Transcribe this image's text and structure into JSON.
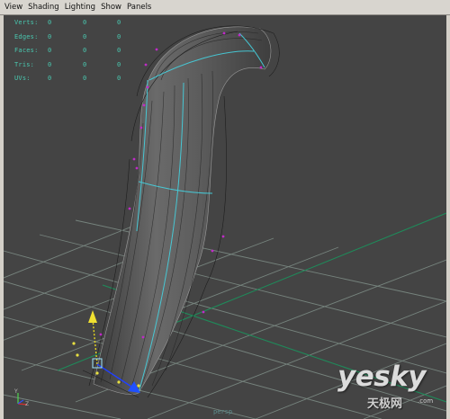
{
  "menu": [
    "View",
    "Shading",
    "Lighting",
    "Show",
    "Panels"
  ],
  "hud": {
    "color": "#49c8b0",
    "rows": [
      {
        "label": "Verts:",
        "v1": "0",
        "v2": "0",
        "v3": "0"
      },
      {
        "label": "Edges:",
        "v1": "0",
        "v2": "0",
        "v3": "0"
      },
      {
        "label": "Faces:",
        "v1": "0",
        "v2": "0",
        "v3": "0"
      },
      {
        "label": "Tris:",
        "v1": "0",
        "v2": "0",
        "v3": "0"
      },
      {
        "label": "UVs:",
        "v1": "0",
        "v2": "0",
        "v3": "0"
      }
    ]
  },
  "viewport": {
    "background": "#444444",
    "grid_color": "#7f8f88",
    "grid_axis_color": "#1f8a5a",
    "camera": "persp"
  },
  "axis": {
    "y": "Y",
    "z": "Z"
  },
  "watermark": {
    "logo": "yesky",
    "sub": "天极网",
    "suffix": ".com"
  }
}
